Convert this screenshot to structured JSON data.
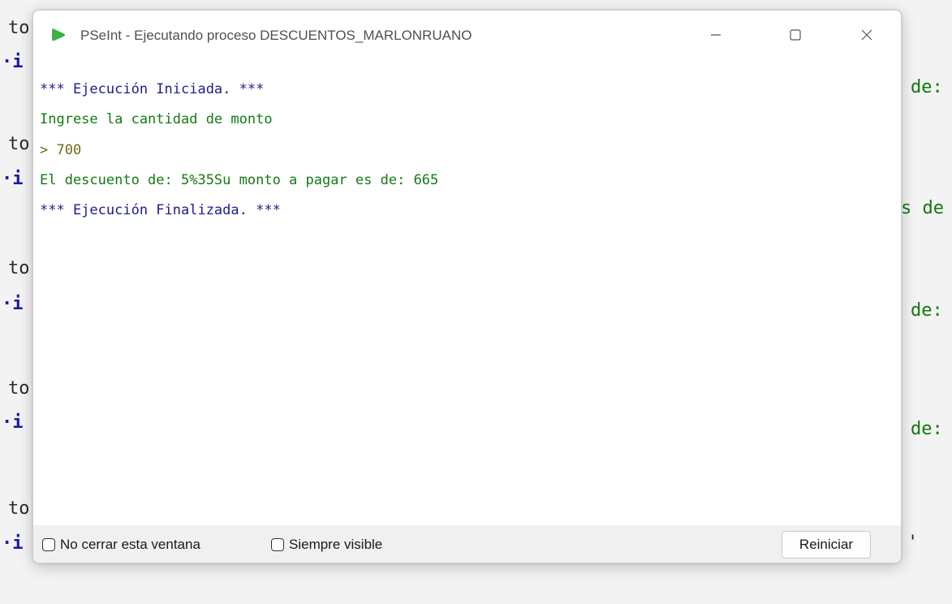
{
  "background_editor": {
    "left_fragments": [
      {
        "text": "to",
        "style": "dark"
      },
      {
        "text": "·i",
        "style": "blue"
      },
      {
        "text": "to",
        "style": "dark"
      },
      {
        "text": "·i",
        "style": "blue"
      },
      {
        "text": "to",
        "style": "dark"
      },
      {
        "text": "·i",
        "style": "blue"
      },
      {
        "text": "to",
        "style": "dark"
      },
      {
        "text": "·i",
        "style": "blue"
      },
      {
        "text": "to",
        "style": "dark"
      },
      {
        "text": "·i",
        "style": "blue"
      }
    ],
    "right_fragments": [
      "de:",
      "s de",
      "de:",
      "de:",
      "'"
    ]
  },
  "window": {
    "title": "PSeInt - Ejecutando proceso DESCUENTOS_MARLONRUANO",
    "controls": [
      "minimize",
      "maximize",
      "close"
    ],
    "accent_color": "#3cb043"
  },
  "console": {
    "lines": [
      {
        "text": "*** Ejecución Iniciada. ***",
        "color": "#1c1c8c"
      },
      {
        "text": "Ingrese la cantidad de monto",
        "color": "#147a14"
      },
      {
        "text": "> 700",
        "color": "#6b6b14"
      },
      {
        "text": "El descuento de: 5%35Su monto a pagar es de: 665",
        "color": "#147a14"
      },
      {
        "text": "*** Ejecución Finalizada. ***",
        "color": "#1c1c8c"
      }
    ]
  },
  "bottom_bar": {
    "no_close_label": "No cerrar esta ventana",
    "no_close_checked": false,
    "always_visible_label": "Siempre visible",
    "always_visible_checked": false,
    "restart_label": "Reiniciar"
  }
}
